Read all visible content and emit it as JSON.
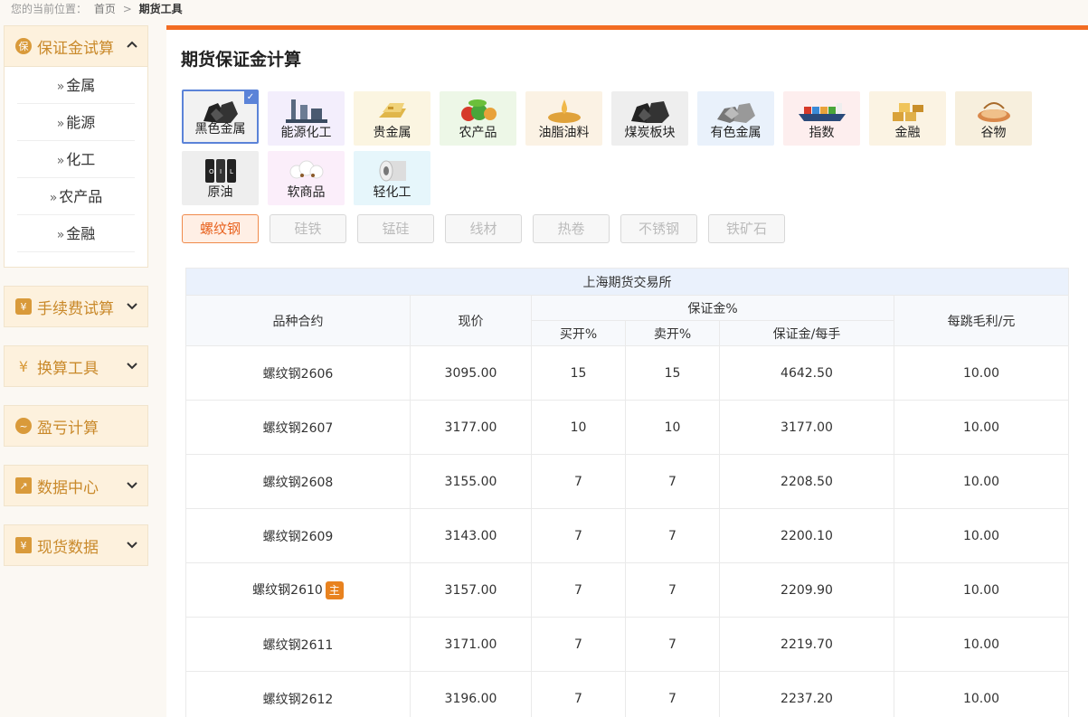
{
  "breadcrumb": {
    "prefix": "您的当前位置：",
    "home": "首页",
    "sep": ">",
    "current": "期货工具"
  },
  "sidebar": {
    "sections": [
      {
        "title": "保证金试算",
        "icon": "保",
        "expanded": true,
        "items": [
          "金属",
          "能源",
          "化工",
          "农产品",
          "金融"
        ]
      },
      {
        "title": "手续费试算",
        "icon": "¥"
      },
      {
        "title": "换算工具",
        "icon": "¥"
      },
      {
        "title": "盈亏计算",
        "icon": "~"
      },
      {
        "title": "数据中心",
        "icon": "↗"
      },
      {
        "title": "现货数据",
        "icon": "¥"
      }
    ]
  },
  "main": {
    "title": "期货保证金计算",
    "categories": [
      {
        "label": "黑色金属",
        "bg": "#f2f2f2",
        "selected": true,
        "icon": "coal-icon"
      },
      {
        "label": "能源化工",
        "bg": "#f3eefc",
        "icon": "refinery-icon"
      },
      {
        "label": "贵金属",
        "bg": "#fbf5e1",
        "icon": "gold-bar-icon"
      },
      {
        "label": "农产品",
        "bg": "#edf7e7",
        "icon": "vegetables-icon"
      },
      {
        "label": "油脂油料",
        "bg": "#fbf2e4",
        "icon": "oil-seed-icon"
      },
      {
        "label": "煤炭板块",
        "bg": "#eeeeee",
        "icon": "coal-icon"
      },
      {
        "label": "有色金属",
        "bg": "#e9f1fb",
        "icon": "metal-icon"
      },
      {
        "label": "指数",
        "bg": "#fdeeee",
        "icon": "ship-icon"
      },
      {
        "label": "金融",
        "bg": "#fbf3e3",
        "icon": "gold-bars-icon"
      },
      {
        "label": "谷物",
        "bg": "#f7efdd",
        "icon": "grain-icon"
      },
      {
        "label": "原油",
        "bg": "#eeeeee",
        "icon": "oil-barrel-icon"
      },
      {
        "label": "软商品",
        "bg": "#fbeefa",
        "icon": "cotton-icon"
      },
      {
        "label": "轻化工",
        "bg": "#e6f6fb",
        "icon": "paper-roll-icon"
      }
    ],
    "sub_tabs": [
      "螺纹钢",
      "硅铁",
      "锰硅",
      "线材",
      "热卷",
      "不锈钢",
      "铁矿石"
    ],
    "table": {
      "exchange": "上海期货交易所",
      "headers": {
        "variety": "品种合约",
        "price": "现价",
        "margin_group": "保证金%",
        "buy": "买开%",
        "sell": "卖开%",
        "per_lot": "保证金/每手",
        "tick_profit": "每跳毛利/元"
      },
      "main_badge": "主",
      "rows": [
        {
          "contract": "螺纹钢2606",
          "price": "3095.00",
          "buy": "15",
          "sell": "15",
          "margin": "4642.50",
          "tick": "10.00"
        },
        {
          "contract": "螺纹钢2607",
          "price": "3177.00",
          "buy": "10",
          "sell": "10",
          "margin": "3177.00",
          "tick": "10.00"
        },
        {
          "contract": "螺纹钢2608",
          "price": "3155.00",
          "buy": "7",
          "sell": "7",
          "margin": "2208.50",
          "tick": "10.00"
        },
        {
          "contract": "螺纹钢2609",
          "price": "3143.00",
          "buy": "7",
          "sell": "7",
          "margin": "2200.10",
          "tick": "10.00"
        },
        {
          "contract": "螺纹钢2610",
          "main": true,
          "price": "3157.00",
          "buy": "7",
          "sell": "7",
          "margin": "2209.90",
          "tick": "10.00"
        },
        {
          "contract": "螺纹钢2611",
          "price": "3171.00",
          "buy": "7",
          "sell": "7",
          "margin": "2219.70",
          "tick": "10.00"
        },
        {
          "contract": "螺纹钢2612",
          "price": "3196.00",
          "buy": "7",
          "sell": "7",
          "margin": "2237.20",
          "tick": "10.00"
        }
      ]
    }
  }
}
